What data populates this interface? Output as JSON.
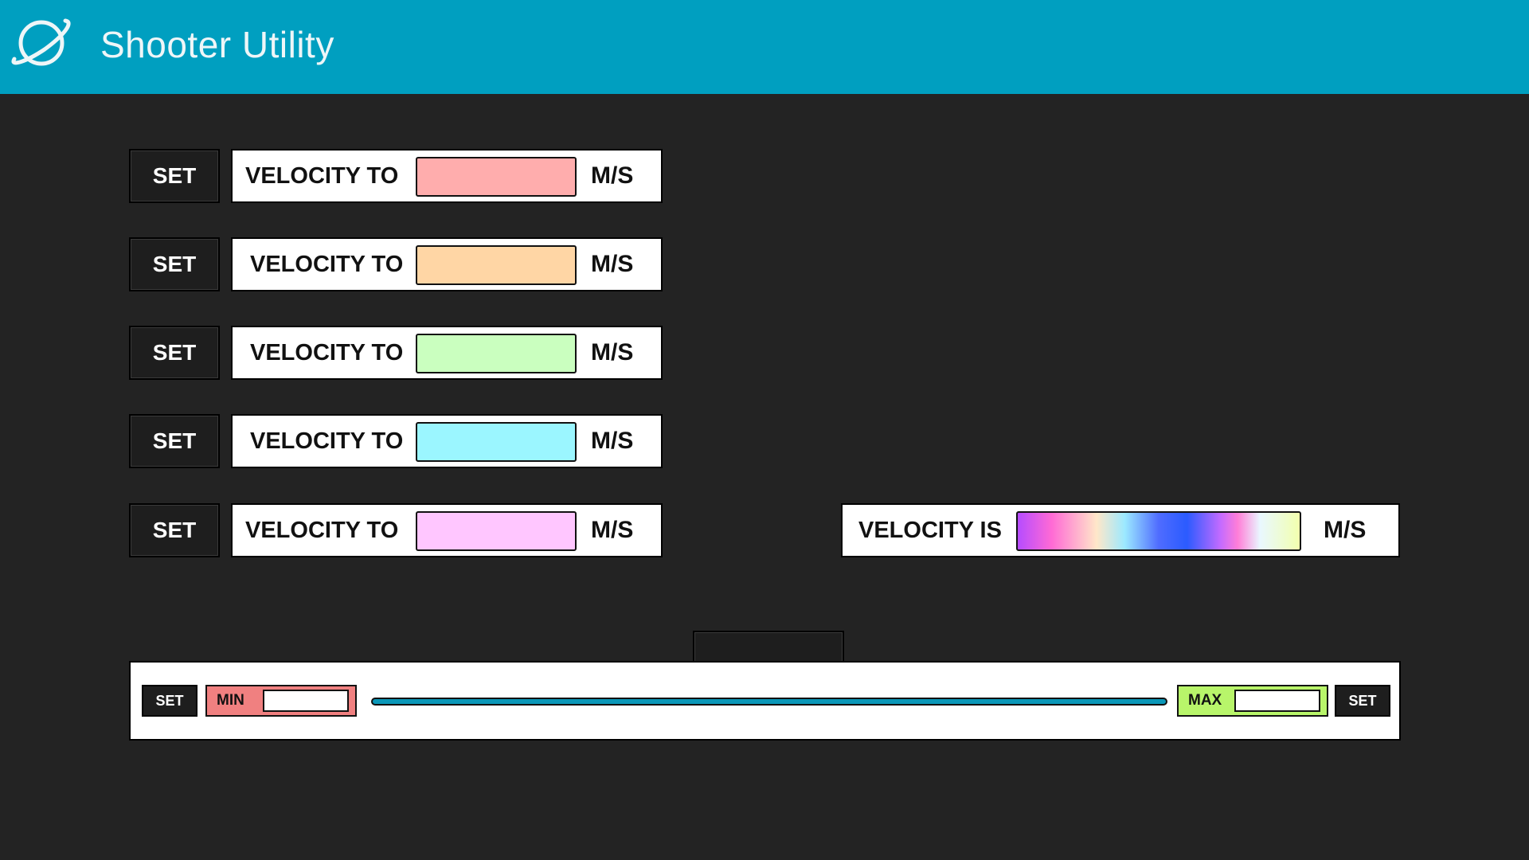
{
  "app": {
    "title": "Shooter Utility",
    "logo_icon": "planet-ring-icon"
  },
  "rows": [
    {
      "set_label": "SET",
      "label": "VELOCITY TO",
      "unit": "M/S",
      "value": "",
      "color": "#ffadad"
    },
    {
      "set_label": "SET",
      "label": "VELOCITY TO",
      "unit": "M/S",
      "value": "",
      "color": "#ffd6a5"
    },
    {
      "set_label": "SET",
      "label": "VELOCITY TO",
      "unit": "M/S",
      "value": "",
      "color": "#caffbf"
    },
    {
      "set_label": "SET",
      "label": "VELOCITY TO",
      "unit": "M/S",
      "value": "",
      "color": "#9bf6ff"
    },
    {
      "set_label": "SET",
      "label": "VELOCITY TO",
      "unit": "M/S",
      "value": "",
      "color": "#ffc6ff"
    }
  ],
  "readout": {
    "label": "VELOCITY IS",
    "unit": "M/S"
  },
  "range": {
    "min_set_label": "SET",
    "min_label": "MIN",
    "min_value": "",
    "min_color": "#f08080",
    "max_label": "MAX",
    "max_value": "",
    "max_color": "#b8f56a",
    "max_set_label": "SET",
    "track_color": "#0a97b8"
  },
  "theme": {
    "header_color": "#009fc0",
    "background": "#232323"
  }
}
